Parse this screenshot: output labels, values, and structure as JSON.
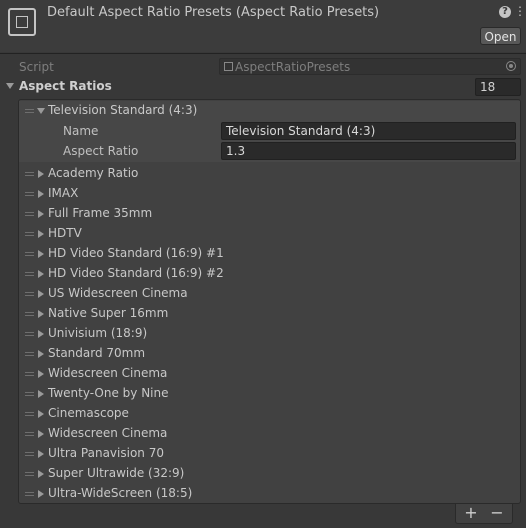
{
  "header": {
    "title": "Default Aspect Ratio Presets (Aspect Ratio Presets)",
    "open_label": "Open",
    "help_icon": "?",
    "menu_icon": "⋮"
  },
  "script": {
    "label": "Script",
    "value": "AspectRatioPresets"
  },
  "aspect_ratios": {
    "label": "Aspect Ratios",
    "count": "18",
    "expanded_item": {
      "label": "Television Standard (4:3)",
      "name_label": "Name",
      "name_value": "Television Standard (4:3)",
      "ratio_label": "Aspect Ratio",
      "ratio_value": "1.3"
    },
    "items": [
      "Academy Ratio",
      "IMAX",
      "Full Frame 35mm",
      "HDTV",
      "HD Video Standard (16:9) #1",
      "HD Video Standard (16:9) #2",
      "US Widescreen Cinema",
      "Native Super 16mm",
      "Univisium (18:9)",
      "Standard 70mm",
      "Widescreen Cinema",
      "Twenty-One by Nine",
      "Cinemascope",
      "Widescreen Cinema",
      "Ultra Panavision 70",
      "Super Ultrawide (32:9)",
      "Ultra-WideScreen (18:5)"
    ]
  },
  "footer": {
    "add_label": "+",
    "remove_label": "−"
  }
}
